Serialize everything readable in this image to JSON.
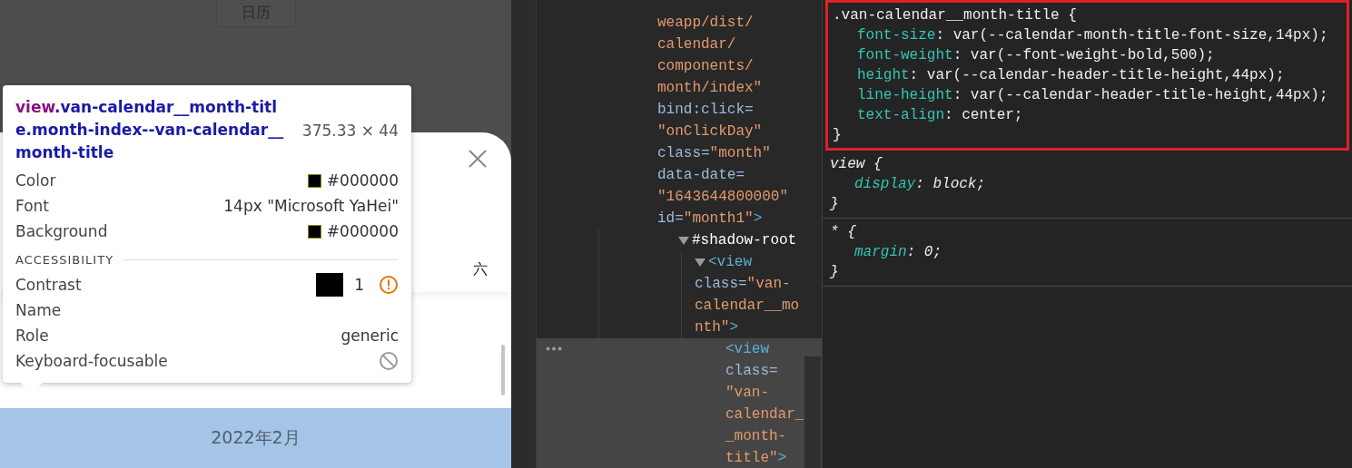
{
  "simulator": {
    "button": {
      "label": "日历"
    },
    "sheet": {
      "weekdays": [
        "六"
      ],
      "month_title": {
        "text": "2022年2月",
        "highlighted": true
      }
    },
    "inspect_tooltip": {
      "tag": "view",
      "classes": ".van-calendar__month-title.month-index--van-calendar__month-title",
      "size": "375.33 × 44",
      "rows": [
        {
          "kind": "swatch",
          "label": "Color",
          "value": "#000000",
          "color": "#000000"
        },
        {
          "kind": "text",
          "label": "Font",
          "value": "14px \"Microsoft YaHei\""
        },
        {
          "kind": "swatch",
          "label": "Background",
          "value": "#000000",
          "color": "#000000"
        }
      ],
      "section": "ACCESSIBILITY",
      "a11y_rows": [
        {
          "kind": "contrast",
          "label": "Contrast",
          "value": "1",
          "color": "#000000"
        },
        {
          "kind": "text",
          "label": "Name"
        },
        {
          "kind": "text",
          "label": "Role",
          "value": "generic"
        },
        {
          "kind": "blocked",
          "label": "Keyboard-focusable"
        }
      ]
    }
  },
  "elements": {
    "nodes": [
      {
        "selected": false,
        "lines": [
          [
            {
              "kind": "value",
              "text": "weapp/dist/"
            }
          ],
          [
            {
              "kind": "value",
              "text": "calendar/"
            }
          ],
          [
            {
              "kind": "value",
              "text": "components/"
            }
          ],
          [
            {
              "kind": "value",
              "text": "month/index\""
            }
          ],
          [
            {
              "kind": "attr",
              "text": "bind:click="
            }
          ],
          [
            {
              "kind": "value",
              "text": "\"onClickDay\""
            }
          ],
          [
            {
              "kind": "attr",
              "text": "class="
            },
            {
              "kind": "value",
              "text": "\"month\""
            }
          ],
          [
            {
              "kind": "attr",
              "text": "data-date="
            }
          ],
          [
            {
              "kind": "value",
              "text": "\"1643644800000\""
            }
          ],
          [
            {
              "kind": "attr",
              "text": "id="
            },
            {
              "kind": "value",
              "text": "\"month1\""
            },
            {
              "kind": "tag",
              "text": ">"
            }
          ]
        ],
        "children": [
          {
            "expanded": true,
            "selected": false,
            "lines": [
              [
                {
                  "kind": "plain",
                  "text": "#shadow-root"
                }
              ]
            ],
            "children": [
              {
                "expanded": true,
                "selected": false,
                "lines": [
                  [
                    {
                      "kind": "tag",
                      "text": "<view"
                    }
                  ],
                  [
                    {
                      "kind": "attr",
                      "text": "class="
                    },
                    {
                      "kind": "value",
                      "text": "\"van-"
                    }
                  ],
                  [
                    {
                      "kind": "value",
                      "text": "calendar__mo"
                    }
                  ],
                  [
                    {
                      "kind": "value",
                      "text": "nth\""
                    },
                    {
                      "kind": "tag",
                      "text": ">"
                    }
                  ]
                ],
                "children": [
                  {
                    "selected": true,
                    "lines": [
                      [
                        {
                          "kind": "tag",
                          "text": "<view"
                        }
                      ],
                      [
                        {
                          "kind": "attr",
                          "text": "class="
                        }
                      ],
                      [
                        {
                          "kind": "value",
                          "text": "\"van-"
                        }
                      ],
                      [
                        {
                          "kind": "value",
                          "text": "calendar_"
                        }
                      ],
                      [
                        {
                          "kind": "value",
                          "text": "_month-"
                        }
                      ],
                      [
                        {
                          "kind": "value",
                          "text": "title\""
                        },
                        {
                          "kind": "tag",
                          "text": ">"
                        }
                      ]
                    ]
                  }
                ]
              }
            ]
          }
        ]
      }
    ]
  },
  "styles": {
    "rules": [
      {
        "selector": ".van-calendar__month-title {",
        "kind": "author",
        "highlighted": true,
        "close": "}",
        "declarations": [
          {
            "property": "font-size",
            "value": ": var(--calendar-month-title-font-size,14px);"
          },
          {
            "property": "font-weight",
            "value": ": var(--font-weight-bold,500);"
          },
          {
            "property": "height",
            "value": ": var(--calendar-header-title-height,44px);"
          },
          {
            "property": "line-height",
            "value": ": var(--calendar-header-title-height,44px);"
          },
          {
            "property": "text-align",
            "value": ": center;"
          }
        ]
      },
      {
        "selector": "view {",
        "kind": "user-agent",
        "highlighted": false,
        "close": "}",
        "declarations": [
          {
            "property": "display",
            "value": ": block;"
          }
        ]
      },
      {
        "selector": "* {",
        "kind": "user-agent",
        "highlighted": false,
        "close": "}",
        "declarations": [
          {
            "property": "margin",
            "value": ": 0;"
          }
        ]
      }
    ]
  }
}
